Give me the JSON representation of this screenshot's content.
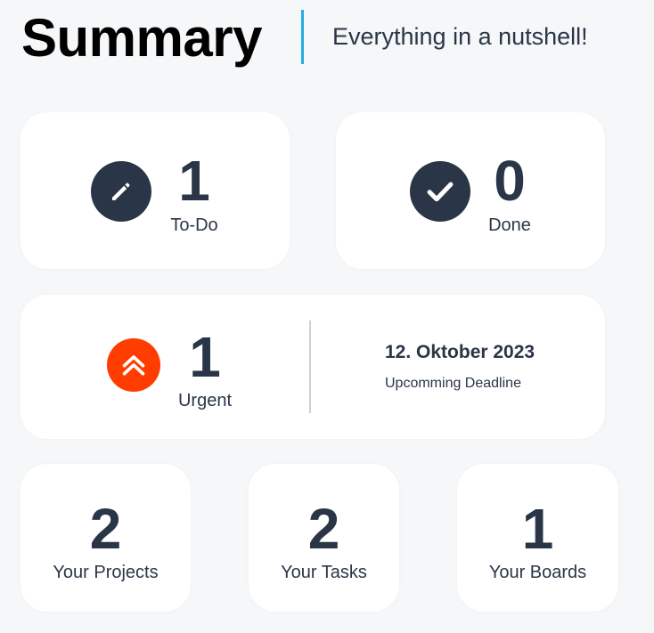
{
  "header": {
    "title": "Summary",
    "subtitle": "Everything in a nutshell!"
  },
  "cards": {
    "todo": {
      "count": "1",
      "label": "To-Do",
      "icon": "pencil-icon"
    },
    "done": {
      "count": "0",
      "label": "Done",
      "icon": "checkmark-icon"
    },
    "urgent": {
      "count": "1",
      "label": "Urgent",
      "icon": "double-chevron-up-icon",
      "deadline_date": "12. Oktober 2023",
      "deadline_label": "Upcomming Deadline"
    },
    "projects": {
      "count": "2",
      "label": "Your Projects"
    },
    "tasks": {
      "count": "2",
      "label": "Your Tasks"
    },
    "boards": {
      "count": "1",
      "label": "Your Boards"
    }
  },
  "colors": {
    "background": "#f6f7f8",
    "primary_dark": "#2a3647",
    "accent_blue": "#29abe2",
    "urgent_orange": "#ff3d00",
    "card": "#ffffff"
  }
}
